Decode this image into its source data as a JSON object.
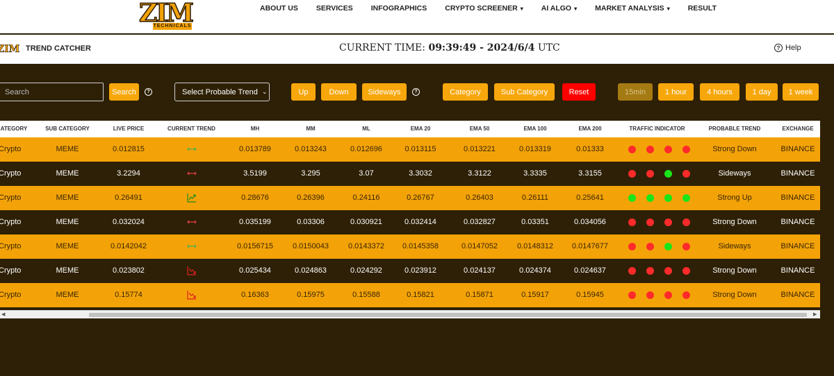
{
  "nav": {
    "logo_text": "ZIM",
    "logo_sub": "TECHNICALS",
    "items": [
      {
        "label": "ABOUT US",
        "dropdown": false
      },
      {
        "label": "SERVICES",
        "dropdown": false
      },
      {
        "label": "INFOGRAPHICS",
        "dropdown": false
      },
      {
        "label": "CRYPTO SCREENER",
        "dropdown": true
      },
      {
        "label": "AI ALGO",
        "dropdown": true
      },
      {
        "label": "MARKET ANALYSIS",
        "dropdown": true
      },
      {
        "label": "RESULT",
        "dropdown": false
      }
    ]
  },
  "subbar": {
    "title": "TREND CATCHER",
    "clock_label": "CURRENT TIME:",
    "clock_value": "09:39:49 - 2024/6/4",
    "clock_tz": "UTC",
    "help_label": "Help"
  },
  "controls": {
    "search_placeholder": "Search",
    "search_button": "Search",
    "trend_select": "Select Probable Trend",
    "up": "Up",
    "down": "Down",
    "sideways": "Sideways",
    "category": "Category",
    "sub_category": "Sub Category",
    "reset": "Reset",
    "timeframes": [
      "15min",
      "1 hour",
      "4 hours",
      "1 day",
      "1 week"
    ],
    "active_timeframe": "15min"
  },
  "colors": {
    "accent": "#f7a70b",
    "background": "#2e2006",
    "reset": "#ff0000",
    "signal_red": "#ff2a2a",
    "signal_green": "#19e619"
  },
  "table": {
    "headers": [
      "ATEGORY",
      "SUB CATEGORY",
      "LIVE PRICE",
      "CURRENT TREND",
      "MH",
      "MM",
      "ML",
      "EMA 20",
      "EMA 50",
      "EMA 100",
      "EMA 200",
      "TRAFFIC INDICATOR",
      "PROBABLE TREND",
      "EXCHANGE"
    ],
    "rows": [
      {
        "category": "Crypto",
        "sub": "MEME",
        "price": "0.012815",
        "trend_icon": "sideways-arrows-icon",
        "mh": "0.013789",
        "mm": "0.013243",
        "ml": "0.012696",
        "ema20": "0.013115",
        "ema50": "0.013221",
        "ema100": "0.013319",
        "ema200": "0.01333",
        "signals": [
          "red",
          "red",
          "red",
          "red"
        ],
        "probable": "Strong Down",
        "exchange": "BINANCE"
      },
      {
        "category": "Crypto",
        "sub": "MEME",
        "price": "3.2294",
        "trend_icon": "sideways-arrows-icon",
        "mh": "3.5199",
        "mm": "3.295",
        "ml": "3.07",
        "ema20": "3.3032",
        "ema50": "3.3122",
        "ema100": "3.3335",
        "ema200": "3.3155",
        "signals": [
          "red",
          "red",
          "green",
          "red"
        ],
        "probable": "Sideways",
        "exchange": "BINANCE"
      },
      {
        "category": "Crypto",
        "sub": "MEME",
        "price": "0.26491",
        "trend_icon": "trend-up-icon",
        "mh": "0.28676",
        "mm": "0.26396",
        "ml": "0.24116",
        "ema20": "0.26767",
        "ema50": "0.26403",
        "ema100": "0.26111",
        "ema200": "0.25641",
        "signals": [
          "green",
          "green",
          "green",
          "green"
        ],
        "probable": "Strong Up",
        "exchange": "BINANCE"
      },
      {
        "category": "Crypto",
        "sub": "MEME",
        "price": "0.032024",
        "trend_icon": "sideways-arrows-icon",
        "mh": "0.035199",
        "mm": "0.03306",
        "ml": "0.030921",
        "ema20": "0.032414",
        "ema50": "0.032827",
        "ema100": "0.03351",
        "ema200": "0.034056",
        "signals": [
          "red",
          "red",
          "red",
          "red"
        ],
        "probable": "Strong Down",
        "exchange": "BINANCE"
      },
      {
        "category": "Crypto",
        "sub": "MEME",
        "price": "0.0142042",
        "trend_icon": "sideways-arrows-icon",
        "mh": "0.0156715",
        "mm": "0.0150043",
        "ml": "0.0143372",
        "ema20": "0.0145358",
        "ema50": "0.0147052",
        "ema100": "0.0148312",
        "ema200": "0.0147677",
        "signals": [
          "red",
          "red",
          "green",
          "red"
        ],
        "probable": "Sideways",
        "exchange": "BINANCE"
      },
      {
        "category": "Crypto",
        "sub": "MEME",
        "price": "0.023802",
        "trend_icon": "trend-down-icon",
        "mh": "0.025434",
        "mm": "0.024863",
        "ml": "0.024292",
        "ema20": "0.023912",
        "ema50": "0.024137",
        "ema100": "0.024374",
        "ema200": "0.024637",
        "signals": [
          "red",
          "red",
          "red",
          "red"
        ],
        "probable": "Strong Down",
        "exchange": "BINANCE"
      },
      {
        "category": "Crypto",
        "sub": "MEME",
        "price": "0.15774",
        "trend_icon": "trend-down-icon",
        "mh": "0.16363",
        "mm": "0.15975",
        "ml": "0.15588",
        "ema20": "0.15821",
        "ema50": "0.15871",
        "ema100": "0.15917",
        "ema200": "0.15945",
        "signals": [
          "red",
          "red",
          "red",
          "red"
        ],
        "probable": "Strong Down",
        "exchange": "BINANCE"
      }
    ]
  }
}
